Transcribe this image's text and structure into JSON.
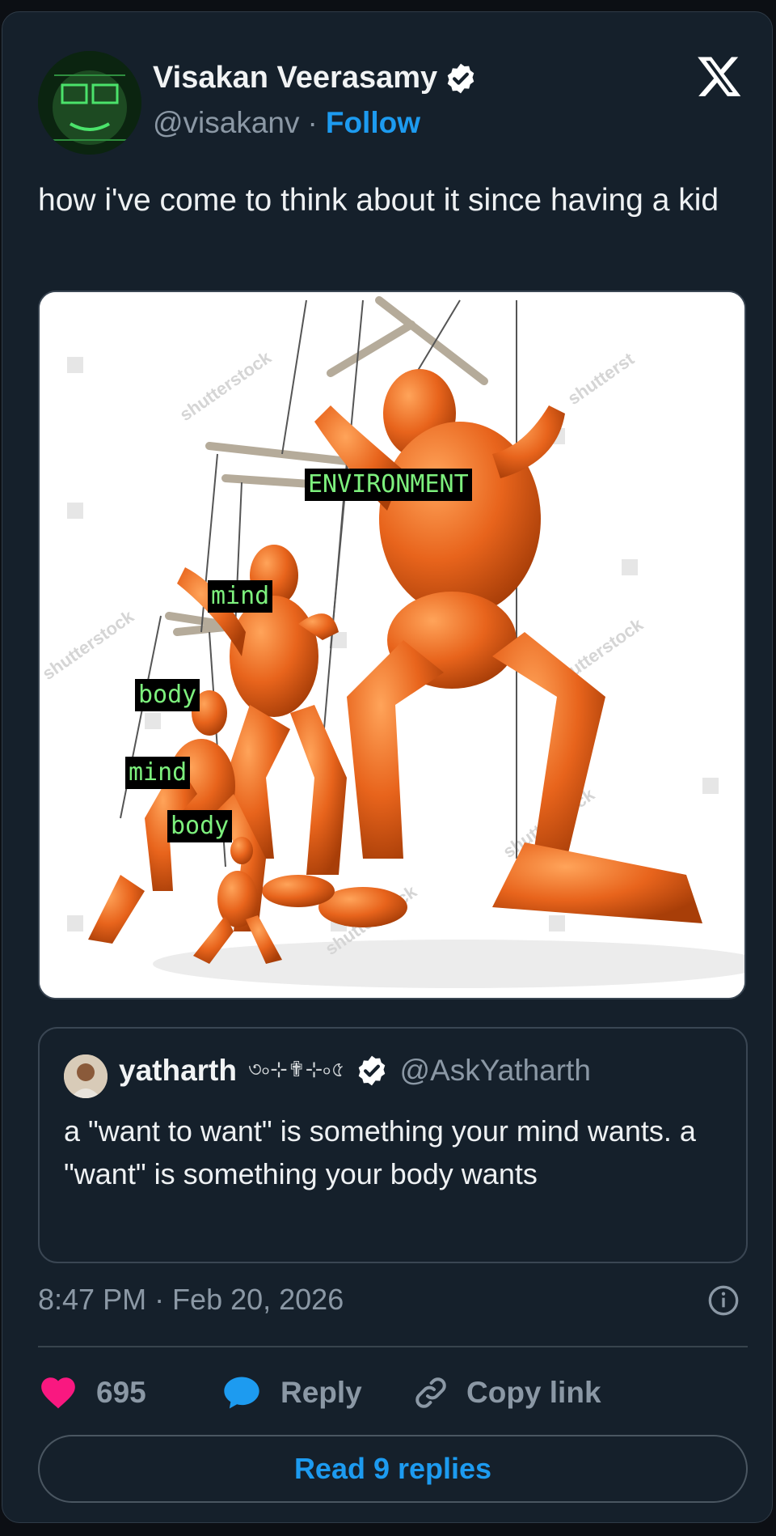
{
  "tweet": {
    "author_name": "Visakan Veerasamy",
    "author_handle": "@visakanv",
    "separator": "·",
    "follow_label": "Follow",
    "text": "how i've come to think about it since having a kid",
    "media_labels": {
      "environment": "ENVIRONMENT",
      "mind_large": "mind",
      "body_large": "body",
      "mind_small": "mind",
      "body_small": "body"
    },
    "watermark": "shutterstock",
    "timestamp": "8:47 PM · Feb 20, 2026",
    "likes": "695",
    "reply_label": "Reply",
    "copy_link_label": "Copy link",
    "read_replies_label": "Read 9 replies"
  },
  "quoted": {
    "author_name": "yatharth",
    "decoration": "৩৹⊹✟⊹৹৫",
    "author_handle": "@AskYatharth",
    "text": "a \"want to want\" is something your mind wants. a \"want\" is something your body wants"
  },
  "colors": {
    "background": "#15202b",
    "accent": "#1d9bf0",
    "like": "#f91880",
    "muted": "#8b98a5",
    "label_text": "#7df07d",
    "mannequin": "#e8641c"
  },
  "icons": [
    "x-logo-icon",
    "verified-icon",
    "info-icon",
    "heart-icon",
    "reply-bubble-icon",
    "link-icon"
  ]
}
